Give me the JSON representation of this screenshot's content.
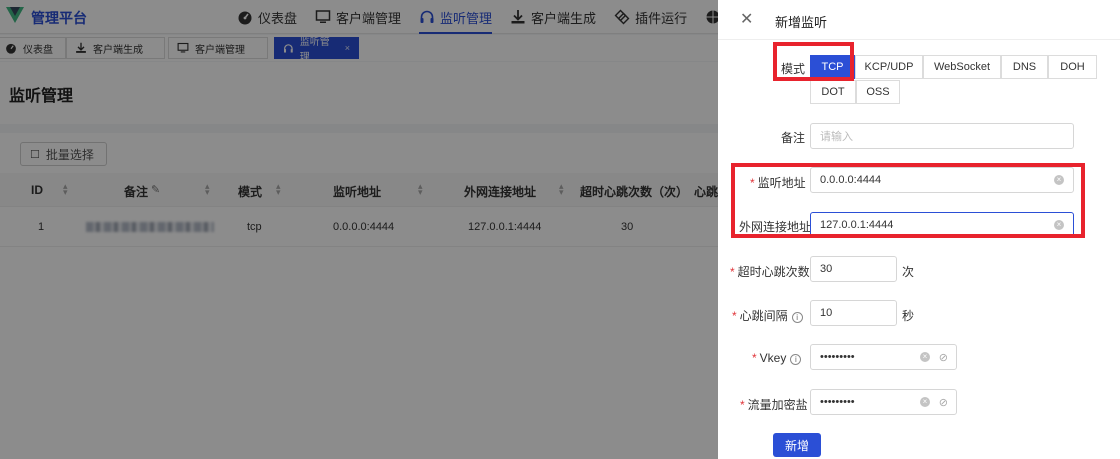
{
  "app": {
    "brand": "管理平台"
  },
  "topnav": [
    {
      "label": "仪表盘",
      "icon": "dashboard-icon"
    },
    {
      "label": "客户端管理",
      "icon": "monitor-icon"
    },
    {
      "label": "监听管理",
      "icon": "headphones-icon",
      "active": true
    },
    {
      "label": "客户端生成",
      "icon": "download-icon"
    },
    {
      "label": "插件运行",
      "icon": "plugin-icon"
    }
  ],
  "tabs": [
    {
      "label": "仪表盘"
    },
    {
      "label": "客户端生成"
    },
    {
      "label": "客户端管理"
    },
    {
      "label": "监听管理",
      "active": true,
      "close": "×"
    }
  ],
  "page": {
    "title": "监听管理",
    "batch_label": "批量选择"
  },
  "table": {
    "headers": [
      "ID",
      "备注",
      "模式",
      "监听地址",
      "外网连接地址",
      "超时心跳次数（次）",
      "心跳"
    ],
    "rows": [
      {
        "id": "1",
        "mode": "tcp",
        "listen": "0.0.0.0:4444",
        "external": "127.0.0.1:4444",
        "timeout": "30"
      }
    ]
  },
  "drawer": {
    "title": "新增监听",
    "mode_label": "模式",
    "modes": [
      "TCP",
      "KCP/UDP",
      "WebSocket",
      "DNS",
      "DOH",
      "DOT",
      "OSS"
    ],
    "selected_mode": "TCP",
    "remark_label": "备注",
    "remark_placeholder": "请输入",
    "listen_label": "监听地址",
    "listen_value": "0.0.0.0:4444",
    "external_label": "外网连接地址",
    "external_value": "127.0.0.1:4444",
    "timeout_label": "超时心跳次数",
    "timeout_value": "30",
    "timeout_unit": "次",
    "interval_label": "心跳间隔",
    "interval_value": "10",
    "interval_unit": "秒",
    "vkey_label": "Vkey",
    "vkey_value": "•••••••••",
    "salt_label": "流量加密盐",
    "salt_value": "•••••••••",
    "submit_label": "新增"
  },
  "colors": {
    "primary": "#2b4fd6",
    "highlight": "#e8232d",
    "required": "#e0353a"
  }
}
